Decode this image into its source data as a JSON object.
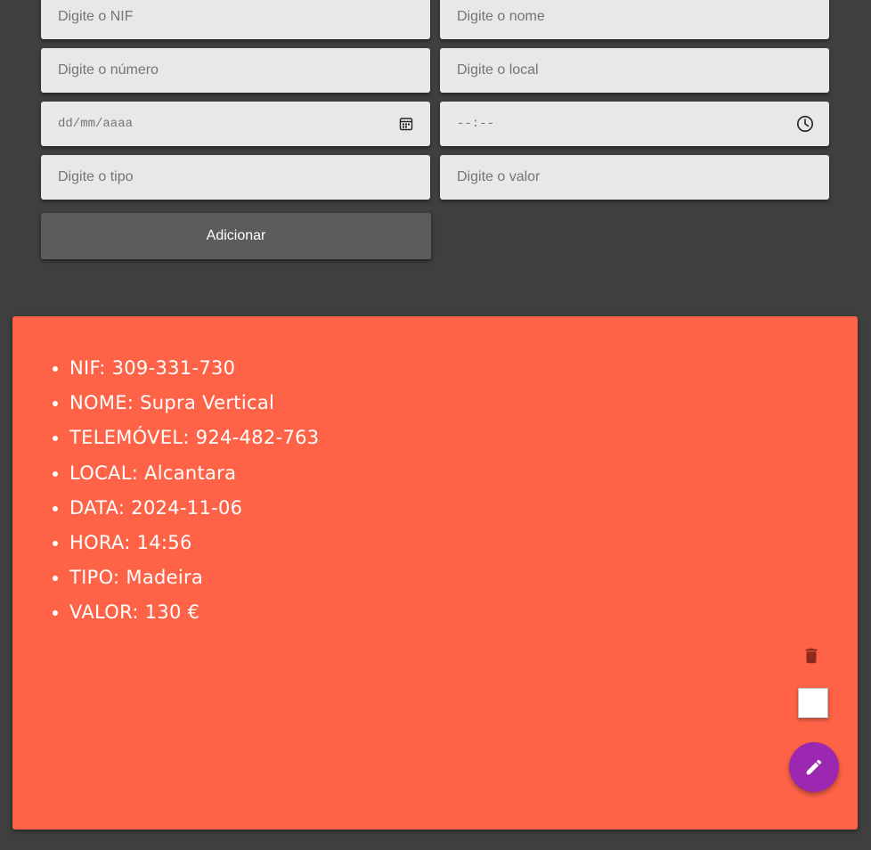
{
  "form": {
    "nif": {
      "placeholder": "Digite o NIF",
      "value": ""
    },
    "nome": {
      "placeholder": "Digite o nome",
      "value": ""
    },
    "numero": {
      "placeholder": "Digite o número",
      "value": ""
    },
    "local": {
      "placeholder": "Digite o local",
      "value": ""
    },
    "data": {
      "placeholder": "dd/mm/aaaa",
      "value": ""
    },
    "hora": {
      "placeholder": "--:--",
      "value": ""
    },
    "tipo": {
      "placeholder": "Digite o tipo",
      "value": ""
    },
    "valor": {
      "placeholder": "Digite o valor",
      "value": ""
    },
    "add_label": "Adicionar",
    "date_icon": "calendar-icon",
    "time_icon": "clock-icon"
  },
  "card": {
    "items": [
      "NIF: 309-331-730",
      "NOME: Supra Vertical",
      "TELEMÓVEL: 924-482-763",
      "LOCAL: Alcantara",
      "DATA: 2024-11-06",
      "HORA: 14:56",
      "TIPO: Madeira",
      "VALOR: 130 €"
    ],
    "delete_icon": "trash-icon",
    "edit_icon": "pencil-icon",
    "checked": false
  },
  "colors": {
    "page_background": "#3f3f3f",
    "input_background": "#e8e8e8",
    "button_background": "#5c5c5c",
    "card_background": "#ff6347",
    "fab_background": "#9c27b0",
    "trash_color": "#8b2a1a"
  }
}
